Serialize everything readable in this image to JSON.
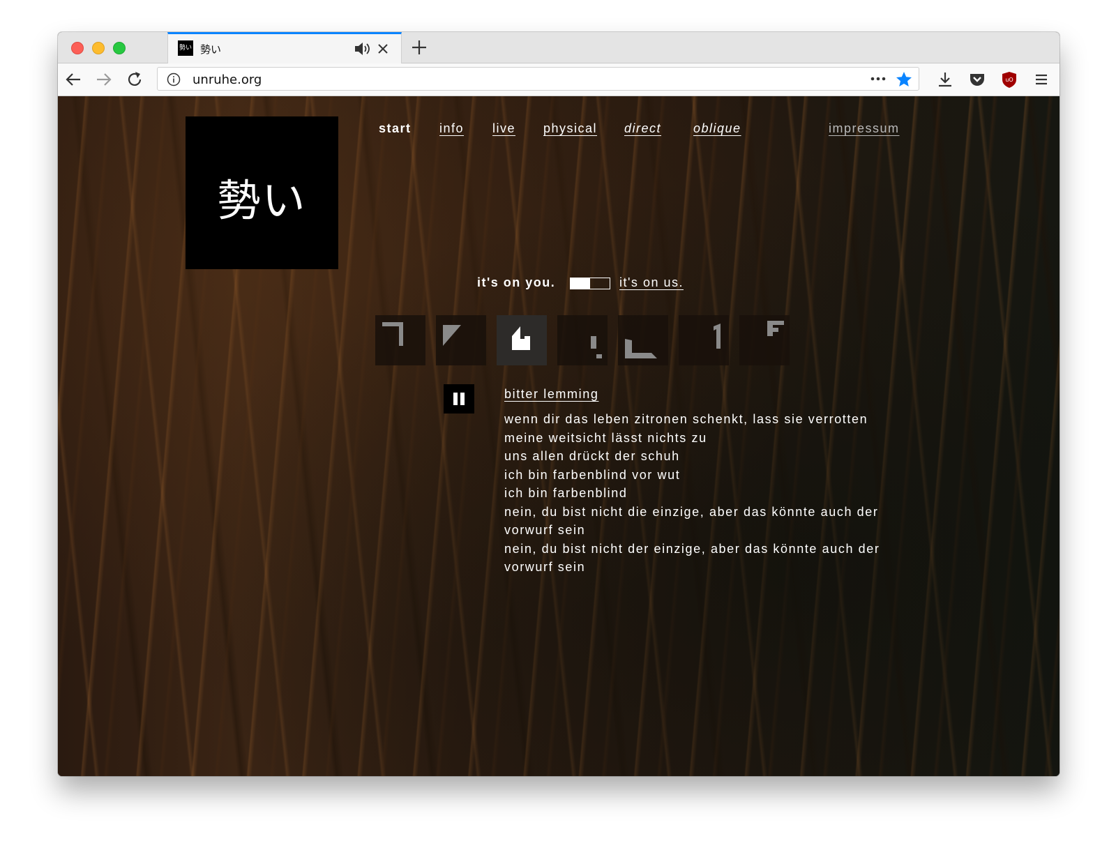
{
  "browser": {
    "tab": {
      "favicon_text": "勢い",
      "title": "勢い"
    },
    "url": "unruhe.org",
    "colors": {
      "accent": "#0a84ff",
      "bookmark_star": "#0a84ff",
      "ublock": "#a00000"
    }
  },
  "logo": {
    "text": "勢い"
  },
  "nav": {
    "start": "start",
    "info": "info",
    "live": "live",
    "physical": "physical",
    "direct": "direct",
    "oblique": "oblique",
    "impressum": "impressum"
  },
  "toggle": {
    "left_label": "it's on you.",
    "right_label": "it's on us."
  },
  "glyphs": [
    "glyph-1",
    "glyph-2",
    "glyph-3",
    "glyph-4",
    "glyph-5",
    "glyph-6",
    "glyph-7"
  ],
  "player": {
    "state": "playing",
    "track_title": "bitter lemming",
    "lyrics": [
      "wenn dir das leben zitronen schenkt, lass sie verrotten",
      "meine weitsicht lässt nichts zu",
      "uns allen drückt der schuh",
      "ich bin farbenblind vor wut",
      "ich bin farbenblind",
      "nein, du bist nicht die einzige, aber das könnte auch der vorwurf sein",
      "nein, du bist nicht der einzige, aber das könnte auch der vorwurf sein"
    ]
  }
}
